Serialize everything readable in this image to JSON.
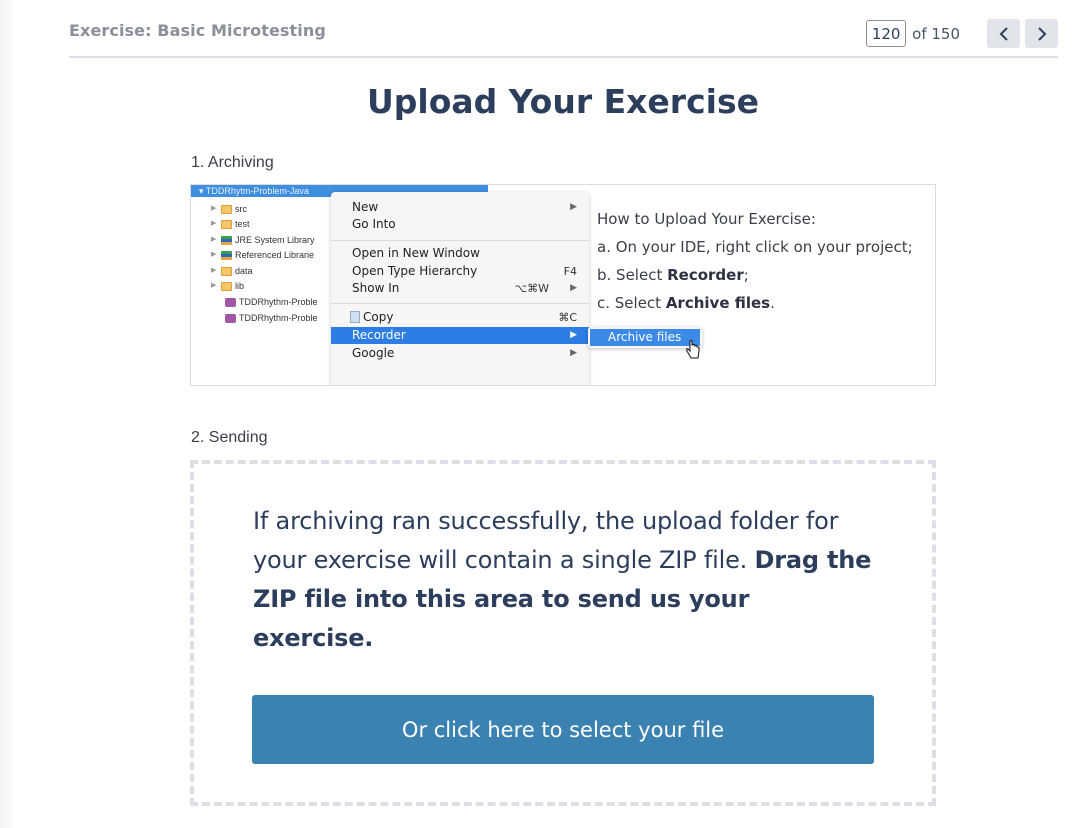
{
  "header": {
    "exercise_title": "Exercise: Basic Microtesting",
    "pager": {
      "current_page": "120",
      "of_label": "of 150",
      "prev_icon": "chevron-left-icon",
      "next_icon": "chevron-right-icon"
    }
  },
  "page_title": "Upload Your Exercise",
  "step1": {
    "label": "1. Archiving",
    "ide": {
      "root": "TDDRhytm-Problem-Java",
      "tree_items": [
        {
          "label": "src",
          "icon": "package-folder-icon",
          "expandable": true
        },
        {
          "label": "test",
          "icon": "package-folder-icon",
          "expandable": true
        },
        {
          "label": "JRE System Library",
          "icon": "library-icon",
          "expandable": true
        },
        {
          "label": "Referenced Librarie",
          "icon": "library-icon",
          "expandable": true
        },
        {
          "label": "data",
          "icon": "folder-icon",
          "expandable": true
        },
        {
          "label": "lib",
          "icon": "folder-icon",
          "expandable": true
        },
        {
          "label": "TDDRhythm-Proble",
          "icon": "file-icon",
          "expandable": false
        },
        {
          "label": "TDDRhythm-Proble",
          "icon": "file-icon",
          "expandable": false
        }
      ],
      "context_menu": [
        {
          "label": "New",
          "shortcut": "",
          "submenu": true
        },
        {
          "label": "Go Into",
          "shortcut": "",
          "submenu": false
        },
        {
          "label": "Open in New Window",
          "shortcut": "",
          "submenu": false
        },
        {
          "label": "Open Type Hierarchy",
          "shortcut": "F4",
          "submenu": false
        },
        {
          "label": "Show In",
          "shortcut": "⌥⌘W",
          "submenu": true
        },
        {
          "label": "Copy",
          "shortcut": "⌘C",
          "submenu": false
        },
        {
          "label": "Recorder",
          "shortcut": "",
          "submenu": true,
          "active": true
        },
        {
          "label": "Google",
          "shortcut": "",
          "submenu": true
        }
      ],
      "submenu_item": "Archive files"
    },
    "instructions": {
      "heading": "How to Upload Your Exercise:",
      "a": "a. On your IDE, right click on your project;",
      "b_prefix": "b. Select ",
      "b_bold": "Recorder",
      "b_suffix": ";",
      "c_prefix": "c. Select ",
      "c_bold": "Archive files",
      "c_suffix": "."
    }
  },
  "step2": {
    "label": "2. Sending",
    "drop_text": "If archiving ran successfully, the upload folder for your exercise will contain a single ZIP file.",
    "drop_text_bold": "Drag the ZIP file into this area to send us your exercise.",
    "select_button": "Or click here to select your file"
  },
  "colors": {
    "title": "#2c3e5c",
    "button": "#3a82b1",
    "dashed_border": "#dcdfe3",
    "nav_button_bg": "#e1e4e8"
  }
}
